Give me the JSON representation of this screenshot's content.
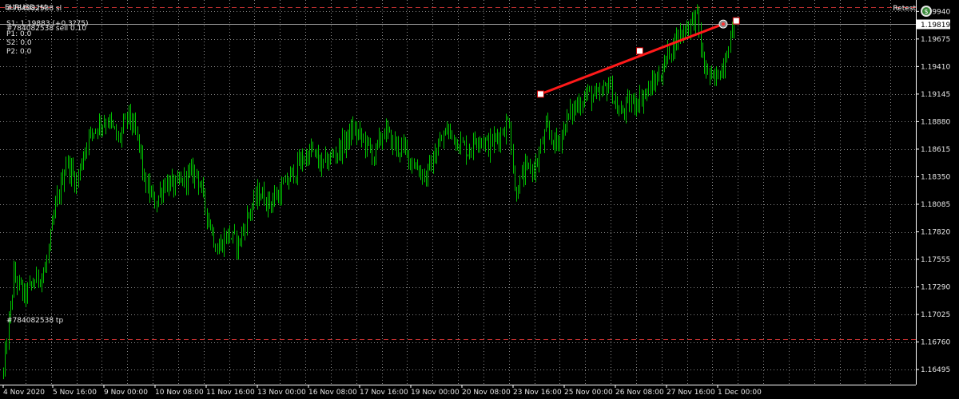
{
  "header": {
    "symbol_line": "EURUSD,H4",
    "trade_lines": [
      "#784082538 sl",
      "#784082538 sell 0.10",
      "S1: 1.19883 (+0.3?75)",
      "P1: 0.0",
      "S2: 0.0",
      "P2: 0.0"
    ],
    "tp_label": "#784082538 tp",
    "retest_label": "Retest"
  },
  "colors": {
    "background": "#000000",
    "grid": "#8a8a8a",
    "candles": "#00c000",
    "trend_line": "#ff1a1a",
    "level_lines": "#c83232",
    "axis": "#ffffff",
    "current_price_box": "#ffffff"
  },
  "chart_data": {
    "type": "candlestick",
    "symbol": "EURUSD",
    "timeframe": "H4",
    "ylim": [
      1.1635,
      1.2005
    ],
    "y_ticks": [
      "1.19940",
      "1.19675",
      "1.19410",
      "1.19145",
      "1.18880",
      "1.18615",
      "1.18350",
      "1.18085",
      "1.17820",
      "1.17555",
      "1.17290",
      "1.17025",
      "1.16760",
      "1.16495"
    ],
    "current_price": "1.19819",
    "x_ticks": [
      "4 Nov 2020",
      "5 Nov 16:00",
      "9 Nov 00:00",
      "10 Nov 08:00",
      "11 Nov 16:00",
      "13 Nov 00:00",
      "16 Nov 08:00",
      "17 Nov 16:00",
      "19 Nov 00:00",
      "20 Nov 08:00",
      "23 Nov 16:00",
      "25 Nov 00:00",
      "26 Nov 08:00",
      "27 Nov 16:00",
      "1 Dec 00:00"
    ],
    "close_path": [
      [
        0,
        1.1646
      ],
      [
        2,
        1.174
      ],
      [
        4,
        1.172
      ],
      [
        6,
        1.1735
      ],
      [
        8,
        1.1745
      ],
      [
        10,
        1.1805
      ],
      [
        12,
        1.185
      ],
      [
        14,
        1.183
      ],
      [
        16,
        1.187
      ],
      [
        18,
        1.1885
      ],
      [
        20,
        1.189
      ],
      [
        22,
        1.187
      ],
      [
        24,
        1.1895
      ],
      [
        26,
        1.1865
      ],
      [
        27,
        1.183
      ],
      [
        29,
        1.181
      ],
      [
        31,
        1.183
      ],
      [
        33,
        1.1825
      ],
      [
        35,
        1.1835
      ],
      [
        37,
        1.184
      ],
      [
        39,
        1.18
      ],
      [
        41,
        1.1765
      ],
      [
        43,
        1.178
      ],
      [
        45,
        1.177
      ],
      [
        47,
        1.18
      ],
      [
        49,
        1.182
      ],
      [
        51,
        1.181
      ],
      [
        53,
        1.182
      ],
      [
        55,
        1.1835
      ],
      [
        57,
        1.185
      ],
      [
        59,
        1.186
      ],
      [
        61,
        1.1845
      ],
      [
        63,
        1.1855
      ],
      [
        65,
        1.1865
      ],
      [
        67,
        1.188
      ],
      [
        69,
        1.187
      ],
      [
        71,
        1.1855
      ],
      [
        73,
        1.188
      ],
      [
        75,
        1.1865
      ],
      [
        77,
        1.186
      ],
      [
        79,
        1.1845
      ],
      [
        81,
        1.1835
      ],
      [
        83,
        1.186
      ],
      [
        85,
        1.188
      ],
      [
        87,
        1.187
      ],
      [
        89,
        1.186
      ],
      [
        91,
        1.1875
      ],
      [
        93,
        1.1865
      ],
      [
        95,
        1.1875
      ],
      [
        97,
        1.189
      ],
      [
        98,
        1.182
      ],
      [
        100,
        1.184
      ],
      [
        102,
        1.1845
      ],
      [
        104,
        1.188
      ],
      [
        106,
        1.1865
      ],
      [
        108,
        1.189
      ],
      [
        110,
        1.1905
      ],
      [
        112,
        1.1915
      ],
      [
        114,
        1.191
      ],
      [
        116,
        1.1925
      ],
      [
        118,
        1.1895
      ],
      [
        120,
        1.1905
      ],
      [
        122,
        1.191
      ],
      [
        124,
        1.192
      ],
      [
        126,
        1.1935
      ],
      [
        128,
        1.196
      ],
      [
        130,
        1.1975
      ],
      [
        132,
        1.1985
      ],
      [
        133,
        1.199
      ],
      [
        134,
        1.1945
      ],
      [
        136,
        1.1925
      ],
      [
        138,
        1.1945
      ],
      [
        140,
        1.1982
      ]
    ],
    "tp_level": 1.1679,
    "top_level": 1.1998,
    "current_level": 1.19819,
    "trend_line": {
      "start": {
        "bar": 103,
        "price": 1.19145
      },
      "mid": {
        "bar": 122,
        "price": 1.1956
      },
      "end": {
        "bar": 138,
        "price": 1.19819
      },
      "extension": {
        "bar": 140.5,
        "price": 1.1985
      }
    }
  }
}
